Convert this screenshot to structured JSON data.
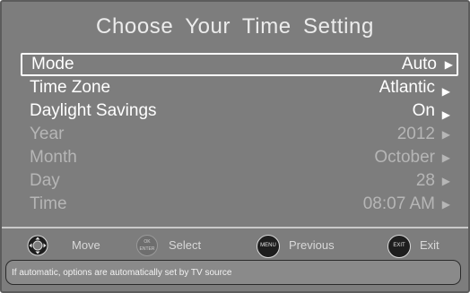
{
  "title": "Choose  Your Time Setting",
  "settings": [
    {
      "label": "Mode",
      "value": "Auto",
      "arrow": "▶"
    },
    {
      "label": "Time Zone",
      "value": "Atlantic",
      "arrow": "▶"
    },
    {
      "label": "Daylight Savings",
      "value": "On",
      "arrow": "▶"
    },
    {
      "label": "Year",
      "value": "2012",
      "arrow": "▶"
    },
    {
      "label": "Month",
      "value": "October",
      "arrow": "▶"
    },
    {
      "label": "Day",
      "value": "28",
      "arrow": "▶"
    },
    {
      "label": "Time",
      "value": "08:07 AM",
      "arrow": "▶"
    }
  ],
  "hints": {
    "move": "Move",
    "select": "Select",
    "previous": "Previous",
    "exit": "Exit",
    "ok_top": "OK",
    "ok_bottom": "ENTER",
    "menu_btn": "MENU",
    "exit_btn": "EXIT"
  },
  "status": "If automatic, options are automatically set by TV source",
  "colors": {
    "panel": "#7d7d7d",
    "text": "#ffffff",
    "dim_text": "#b6b6b6"
  }
}
